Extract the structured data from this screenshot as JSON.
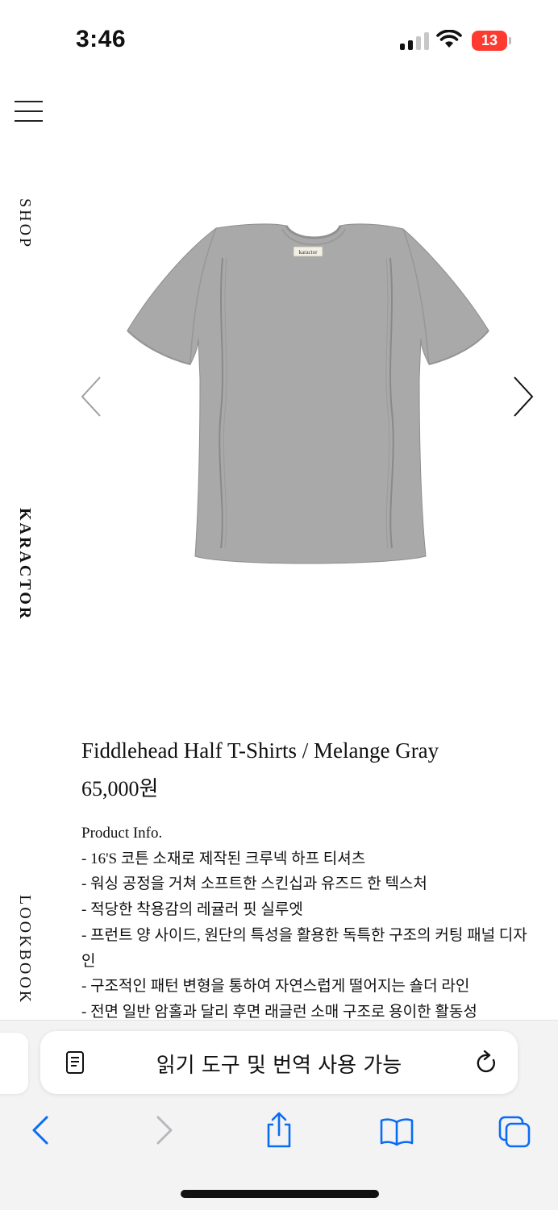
{
  "status_bar": {
    "time": "3:46",
    "battery_level": "13",
    "battery_color": "#ff3b30"
  },
  "nav": {
    "menu_icon": "hamburger-menu-icon",
    "shop_label": "SHOP",
    "brand_label": "KARACTOR",
    "lookbook_label": "LOOKBOOK"
  },
  "product": {
    "image": "gray-crew-neck-t-shirt",
    "tag_text": "karactor",
    "prev_icon": "chevron-left-icon",
    "next_icon": "chevron-right-icon",
    "title": "Fiddlehead Half T-Shirts / Melange Gray",
    "price": "65,000원",
    "info_heading": "Product Info.",
    "info_lines": [
      "- 16'S 코튼 소재로 제작된 크루넥 하프 티셔츠",
      "- 워싱 공정을 거쳐 소프트한 스킨십과 유즈드 한 텍스처",
      "- 적당한 착용감의 레귤러 핏 실루엣",
      "- 프런트 양 사이드, 원단의 특성을 활용한 독특한 구조의 커팅 패널 디자인",
      "- 구조적인 패턴 변형을 통하여 자연스럽게 떨어지는 숄더 라인",
      "- 전면 일반 암홀과 달리 후면 래글런 소매 구조로 용이한 활동성"
    ]
  },
  "browser": {
    "address_text": "읽기 도구 및 번역 사용 가능",
    "reader_icon": "reader-mode-icon",
    "reload_icon": "reload-icon",
    "toolbar_icons": [
      "back-arrow-icon",
      "forward-arrow-icon",
      "share-icon",
      "bookmarks-icon",
      "tabs-icon"
    ],
    "accent_color": "#0a6cf5"
  }
}
